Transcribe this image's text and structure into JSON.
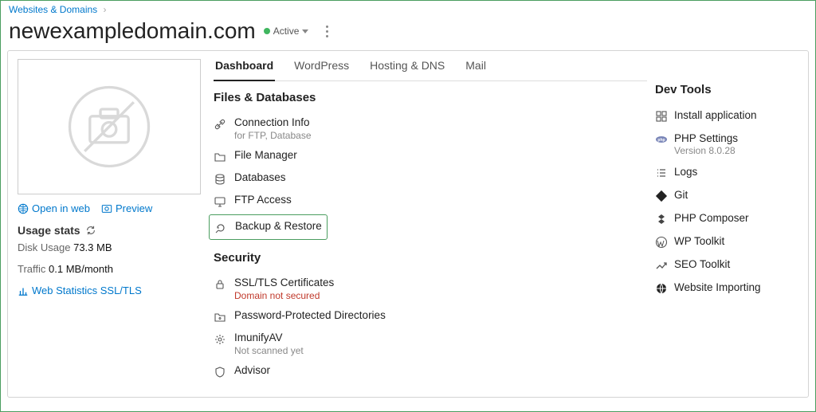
{
  "breadcrumb": {
    "root": "Websites & Domains"
  },
  "header": {
    "domain": "newexampledomain.com",
    "status": "Active"
  },
  "sidebar": {
    "open_in_web": "Open in web",
    "preview": "Preview",
    "usage_title": "Usage stats",
    "disk_label": "Disk Usage",
    "disk_value": "73.3 MB",
    "traffic_label": "Traffic",
    "traffic_value": "0.1 MB/month",
    "web_stats": "Web Statistics SSL/TLS"
  },
  "tabs": [
    {
      "label": "Dashboard",
      "active": true
    },
    {
      "label": "WordPress",
      "active": false
    },
    {
      "label": "Hosting & DNS",
      "active": false
    },
    {
      "label": "Mail",
      "active": false
    }
  ],
  "files_section": {
    "heading": "Files & Databases",
    "items": [
      {
        "title": "Connection Info",
        "sub": "for FTP, Database",
        "icon": "link"
      },
      {
        "title": "File Manager",
        "icon": "folder"
      },
      {
        "title": "Databases",
        "icon": "db"
      },
      {
        "title": "FTP Access",
        "icon": "screen"
      },
      {
        "title": "Backup & Restore",
        "icon": "restore",
        "highlight": true
      }
    ]
  },
  "security_section": {
    "heading": "Security",
    "items": [
      {
        "title": "SSL/TLS Certificates",
        "sub": "Domain not secured",
        "warn": true,
        "icon": "lock"
      },
      {
        "title": "Password-Protected Directories",
        "icon": "pfolder"
      },
      {
        "title": "ImunifyAV",
        "sub": "Not scanned yet",
        "icon": "gear"
      },
      {
        "title": "Advisor",
        "icon": "shield"
      }
    ]
  },
  "dev_section": {
    "heading": "Dev Tools",
    "items": [
      {
        "title": "Install application",
        "icon": "grid"
      },
      {
        "title": "PHP Settings",
        "sub": "Version 8.0.28",
        "icon": "php"
      },
      {
        "title": "Logs",
        "icon": "list"
      },
      {
        "title": "Git",
        "icon": "git"
      },
      {
        "title": "PHP Composer",
        "icon": "composer"
      },
      {
        "title": "WP Toolkit",
        "icon": "wp"
      },
      {
        "title": "SEO Toolkit",
        "icon": "seo"
      },
      {
        "title": "Website Importing",
        "icon": "globe"
      }
    ]
  }
}
